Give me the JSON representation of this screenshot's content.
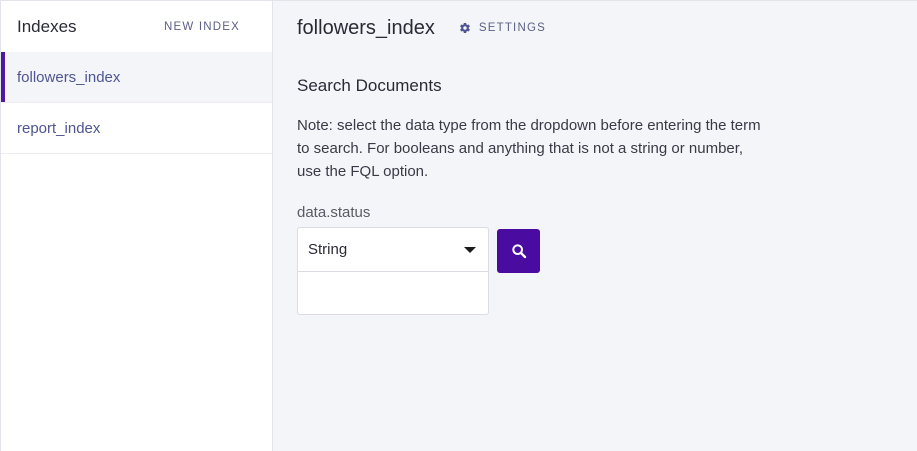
{
  "sidebar": {
    "title": "Indexes",
    "new_index_label": "NEW INDEX",
    "items": [
      {
        "label": "followers_index",
        "active": true
      },
      {
        "label": "report_index",
        "active": false
      }
    ]
  },
  "main": {
    "index_name": "followers_index",
    "settings_label": "SETTINGS",
    "section_title": "Search Documents",
    "note": "Note: select the data type from the dropdown before entering the term to search. For booleans and anything that is not a string or number, use the FQL option.",
    "field_label": "data.status",
    "type_select_value": "String",
    "term_value": "",
    "term_placeholder": ""
  },
  "icons": {
    "settings": "gear-icon",
    "search": "search-icon",
    "dropdown": "caret-down-icon"
  },
  "colors": {
    "accent": "#4a0ca0",
    "link": "#4e5590",
    "main_bg": "#f4f5f9"
  }
}
